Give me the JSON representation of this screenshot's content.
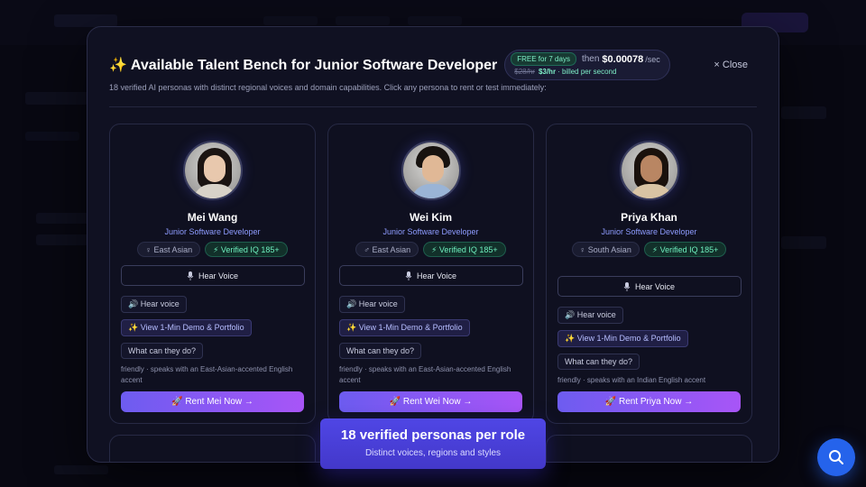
{
  "modal": {
    "sparkle": "✨",
    "title": "Available Talent Bench for Junior Software Developer",
    "pricing": {
      "free_badge": "FREE for 7 days",
      "then": "then",
      "rate": "$0.00078",
      "rate_unit": "/sec",
      "old_price": "$28/hr",
      "new_price": "$3/hr",
      "billing_note": "· billed per second"
    },
    "close_label": "× Close",
    "subtitle": "18 verified AI personas with distinct regional voices and domain capabilities. Click any persona to rent or test immediately:"
  },
  "personas": [
    {
      "name": "Mei Wang",
      "role": "Junior Software Developer",
      "region_tag": "♀ East Asian",
      "iq_tag": "⚡ Verified IQ 185+",
      "hear_voice_btn": "Hear Voice",
      "chip_hear": "🔊 Hear voice",
      "chip_demo": "✨ View 1-Min Demo & Portfolio",
      "chip_what": "What can they do?",
      "desc": "friendly · speaks with an East-Asian-accented English accent",
      "rent_label": "🚀 Rent Mei Now →",
      "colors": {
        "hair": "#1b1412",
        "face": "#e8c8ad",
        "body": "#d8d2c8"
      }
    },
    {
      "name": "Wei Kim",
      "role": "Junior Software Developer",
      "region_tag": "♂ East Asian",
      "iq_tag": "⚡ Verified IQ 185+",
      "hear_voice_btn": "Hear Voice",
      "chip_hear": "🔊 Hear voice",
      "chip_demo": "✨ View 1-Min Demo & Portfolio",
      "chip_what": "What can they do?",
      "desc": "friendly · speaks with an East-Asian-accented English accent",
      "rent_label": "🚀 Rent Wei Now →",
      "colors": {
        "hair": "#17120f",
        "face": "#e0b896",
        "body": "#9ab4d6"
      }
    },
    {
      "name": "Priya Khan",
      "role": "Junior Software Developer",
      "region_tag": "♀ South Asian",
      "iq_tag": "⚡ Verified IQ 185+",
      "hear_voice_btn": "Hear Voice",
      "chip_hear": "🔊 Hear voice",
      "chip_demo": "✨ View 1-Min Demo & Portfolio",
      "chip_what": "What can they do?",
      "desc": "friendly · speaks with an Indian English accent",
      "rent_label": "🚀 Rent Priya Now →",
      "colors": {
        "hair": "#1a110c",
        "face": "#b98663",
        "body": "#d9c4a4"
      }
    }
  ],
  "toast": {
    "title": "18 verified personas per role",
    "subtitle": "Distinct voices, regions and styles"
  },
  "icons": {
    "mic": "mic-icon",
    "search": "search-icon"
  }
}
